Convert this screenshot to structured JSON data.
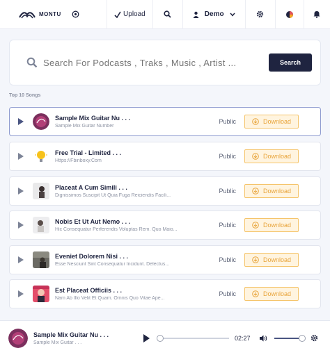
{
  "header": {
    "logo_text": "MONTU",
    "upload_label": "Upload",
    "user_name": "Demo"
  },
  "search": {
    "placeholder": "Search For Podcasts , Traks , Music , Artist ...",
    "button_label": "Search"
  },
  "section_title": "Top 10 Songs",
  "songs": [
    {
      "title": "Sample Mix Guitar Nu . . .",
      "subtitle": "Sample Mix Guitar Number",
      "visibility": "Public",
      "download_label": "Download"
    },
    {
      "title": "Free Trial - Limited . . .",
      "subtitle": "Https://Fbinboxy.Com",
      "visibility": "Public",
      "download_label": "Download"
    },
    {
      "title": "Placeat A Cum Simili . . .",
      "subtitle": "Dignissimos Suscipit Ut Quia Fuga Reiciendis Facili...",
      "visibility": "Public",
      "download_label": "Download"
    },
    {
      "title": "Nobis Et Ut Aut Nemo . . .",
      "subtitle": "Hic Consequatur Perferendis Voluptas Rem. Quo Maio...",
      "visibility": "Public",
      "download_label": "Download"
    },
    {
      "title": "Eveniet Dolorem Nisi . . .",
      "subtitle": "Esse Nesciunt Sint Consequatur Incidunt. Delectus...",
      "visibility": "Public",
      "download_label": "Download"
    },
    {
      "title": "Est Placeat Officiis . . .",
      "subtitle": "Nam Ab Illo Velit Et Quam. Omnis Quo Vitae Ape...",
      "visibility": "Public",
      "download_label": "Download"
    }
  ],
  "player": {
    "title": "Sample Mix Guitar Nu . . .",
    "subtitle": "Sample Mix Guitar . . .",
    "time": "02:27",
    "progress_fraction": 0.0,
    "volume_fraction": 1.0
  },
  "colors": {
    "accent_dark": "#1f2440",
    "download_orange": "#e8a43a",
    "download_bg": "#fff4df",
    "active_border": "#8e9bd0"
  },
  "icons": [
    "logo-icon",
    "target-icon",
    "upload-icon",
    "search-icon",
    "user-icon",
    "chevron-down-icon",
    "gear-icon",
    "theme-toggle-icon",
    "bell-icon",
    "play-icon",
    "download-icon",
    "volume-icon"
  ]
}
